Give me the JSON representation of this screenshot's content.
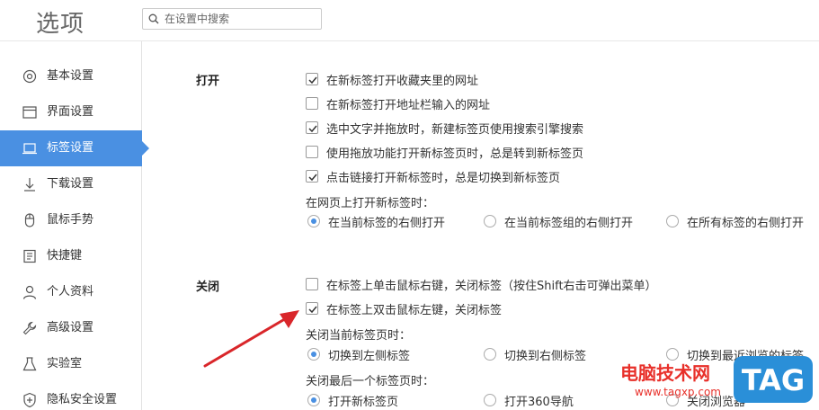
{
  "header": {
    "title": "选项",
    "search_placeholder": "在设置中搜索"
  },
  "sidebar": {
    "items": [
      {
        "label": "基本设置",
        "icon": "gear-icon"
      },
      {
        "label": "界面设置",
        "icon": "window-icon"
      },
      {
        "label": "标签设置",
        "icon": "tab-icon",
        "active": true
      },
      {
        "label": "下载设置",
        "icon": "download-icon"
      },
      {
        "label": "鼠标手势",
        "icon": "mouse-icon"
      },
      {
        "label": "快捷键",
        "icon": "keyboard-icon"
      },
      {
        "label": "个人资料",
        "icon": "user-icon"
      },
      {
        "label": "高级设置",
        "icon": "wrench-icon"
      },
      {
        "label": "实验室",
        "icon": "flask-icon"
      },
      {
        "label": "隐私安全设置",
        "icon": "shield-icon"
      }
    ]
  },
  "open_section": {
    "title": "打开",
    "options": [
      {
        "label": "在新标签打开收藏夹里的网址",
        "checked": true
      },
      {
        "label": "在新标签打开地址栏输入的网址",
        "checked": false
      },
      {
        "label": "选中文字并拖放时，新建标签页使用搜索引擎搜索",
        "checked": true
      },
      {
        "label": "使用拖放功能打开新标签页时，总是转到新标签页",
        "checked": false
      },
      {
        "label": "点击链接打开新标签时，总是切换到新标签页",
        "checked": true
      }
    ],
    "position_label": "在网页上打开新标签时：",
    "position_options": [
      {
        "label": "在当前标签的右侧打开",
        "selected": true
      },
      {
        "label": "在当前标签组的右侧打开",
        "selected": false
      },
      {
        "label": "在所有标签的右侧打开",
        "selected": false
      }
    ]
  },
  "close_section": {
    "title": "关闭",
    "options": [
      {
        "label": "在标签上单击鼠标右键，关闭标签（按住Shift右击可弹出菜单）",
        "checked": false
      },
      {
        "label": "在标签上双击鼠标左键，关闭标签",
        "checked": true
      }
    ],
    "close_current_label": "关闭当前标签页时：",
    "close_current_options": [
      {
        "label": "切换到左侧标签",
        "selected": true
      },
      {
        "label": "切换到右侧标签",
        "selected": false
      },
      {
        "label": "切换到最近浏览的标签",
        "selected": false
      }
    ],
    "close_last_label": "关闭最后一个标签页时：",
    "close_last_options": [
      {
        "label": "打开新标签页",
        "selected": true
      },
      {
        "label": "打开360导航",
        "selected": false
      },
      {
        "label": "关闭浏览器",
        "selected": false
      }
    ]
  },
  "watermark": {
    "text": "电脑技术网",
    "url": "www.tagxp.com",
    "logo": "TAG"
  },
  "colors": {
    "accent": "#4a90e2",
    "arrow": "#d9262a",
    "watermark": "#e8302a"
  }
}
